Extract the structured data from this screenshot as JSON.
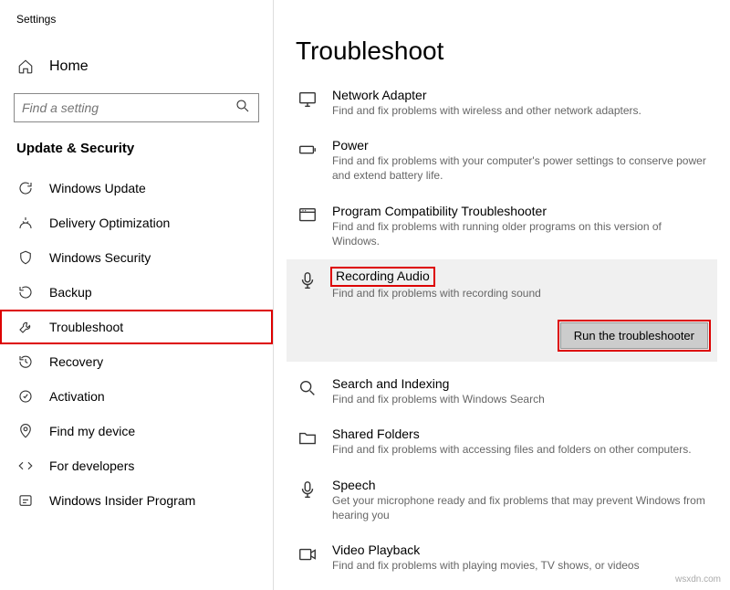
{
  "app_title": "Settings",
  "home_label": "Home",
  "search_placeholder": "Find a setting",
  "section_title": "Update & Security",
  "nav": [
    {
      "label": "Windows Update"
    },
    {
      "label": "Delivery Optimization"
    },
    {
      "label": "Windows Security"
    },
    {
      "label": "Backup"
    },
    {
      "label": "Troubleshoot"
    },
    {
      "label": "Recovery"
    },
    {
      "label": "Activation"
    },
    {
      "label": "Find my device"
    },
    {
      "label": "For developers"
    },
    {
      "label": "Windows Insider Program"
    }
  ],
  "page_title": "Troubleshoot",
  "items": {
    "network": {
      "title": "Network Adapter",
      "desc": "Find and fix problems with wireless and other network adapters."
    },
    "power": {
      "title": "Power",
      "desc": "Find and fix problems with your computer's power settings to conserve power and extend battery life."
    },
    "compat": {
      "title": "Program Compatibility Troubleshooter",
      "desc": "Find and fix problems with running older programs on this version of Windows."
    },
    "recaudio": {
      "title": "Recording Audio",
      "desc": "Find and fix problems with recording sound"
    },
    "search": {
      "title": "Search and Indexing",
      "desc": "Find and fix problems with Windows Search"
    },
    "shared": {
      "title": "Shared Folders",
      "desc": "Find and fix problems with accessing files and folders on other computers."
    },
    "speech": {
      "title": "Speech",
      "desc": "Get your microphone ready and fix problems that may prevent Windows from hearing you"
    },
    "video": {
      "title": "Video Playback",
      "desc": "Find and fix problems with playing movies, TV shows, or videos"
    }
  },
  "run_button": "Run the troubleshooter",
  "watermark": "wsxdn.com"
}
